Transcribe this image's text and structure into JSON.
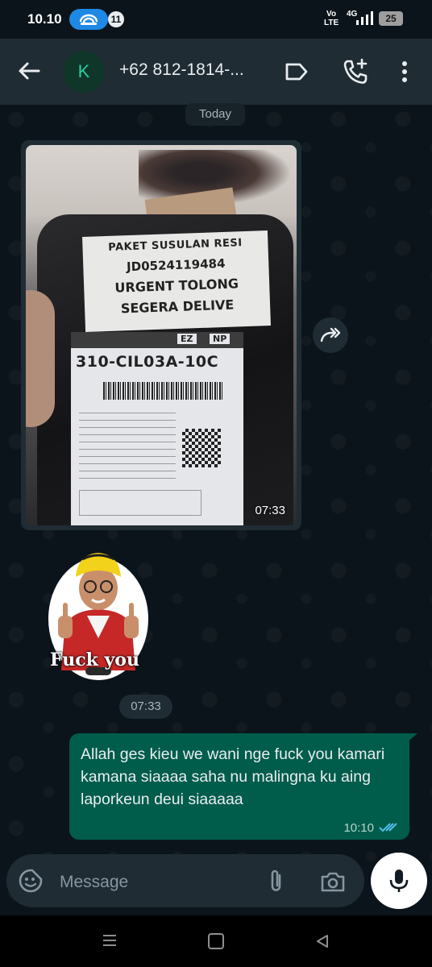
{
  "status_bar": {
    "time": "10.10",
    "notification_count": "11",
    "volte": "Vo\nLTE",
    "network": "4G",
    "battery": "25"
  },
  "header": {
    "avatar_letter": "K",
    "contact_name": "+62 812-1814-..."
  },
  "chat": {
    "date_chip": "Today",
    "image_message": {
      "time": "07:33",
      "photo_label_lines": [
        "PAKET SUSULAN RESI",
        "JD0524119484",
        "URGENT TOLONG",
        "SEGERA DELIVE"
      ],
      "photo_sort_code": "310-CIL03A-10C",
      "photo_tags": [
        "EZ",
        "NP"
      ]
    },
    "sticker": {
      "caption": "Fuck you",
      "time": "07:33"
    },
    "outgoing_message": {
      "text": "Allah ges kieu we wani nge fuck you kamari kamana siaaaa saha nu malingna ku aing laporkeun deui siaaaaa",
      "time": "10:10",
      "status_icon": "double-check-read-icon"
    }
  },
  "composer": {
    "placeholder": "Message"
  },
  "colors": {
    "background": "#0b141a",
    "header": "#1f2c34",
    "outgoing_bubble": "#005c4b",
    "read_ticks": "#53bdeb",
    "avatar_text": "#25d0a0"
  }
}
